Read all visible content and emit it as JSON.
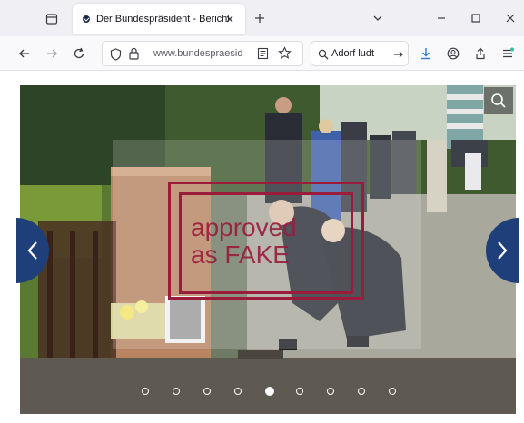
{
  "browser": {
    "tab": {
      "title": "Der Bundespräsident - Berichte"
    },
    "address": {
      "url": "www.bundespraesid"
    },
    "search": {
      "query": "Adorf ludt"
    }
  },
  "slideshow": {
    "stamp_lines": [
      "approved",
      "as FAKE"
    ],
    "slide_count": 9,
    "active_slide": 5
  },
  "colors": {
    "tab_bar": "#f0f0f4",
    "nav_bar": "#f9f9fb",
    "arrow_bg": "#1f3f7a",
    "stamp": "#9b1b3b",
    "accent_download": "#2a7fd4"
  }
}
